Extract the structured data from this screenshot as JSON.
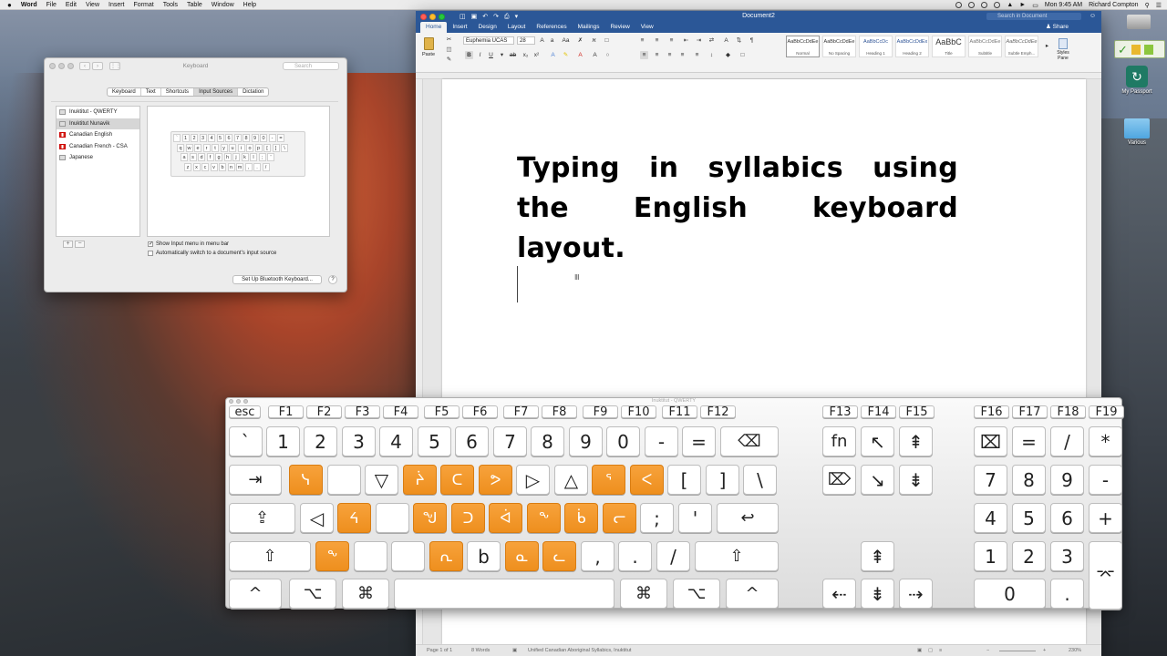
{
  "menubar": {
    "apple": "",
    "app": "Word",
    "items": [
      "File",
      "Edit",
      "View",
      "Insert",
      "Format",
      "Tools",
      "Table",
      "Window",
      "Help"
    ],
    "time": "Mon 9:45 AM",
    "user": "Richard Compton"
  },
  "desktop": {
    "icons": [
      {
        "label": "",
        "icon": "hard-drive-icon"
      },
      {
        "label": "My Passport",
        "icon": "time-machine-drive-icon"
      },
      {
        "label": "Various",
        "icon": "folder-icon"
      }
    ]
  },
  "prefs": {
    "title": "Keyboard",
    "search_placeholder": "Search",
    "tabs": [
      "Keyboard",
      "Text",
      "Shortcuts",
      "Input Sources",
      "Dictation"
    ],
    "selected_tab": "Input Sources",
    "sources": [
      {
        "label": "Inuktitut - QWERTY",
        "flag": "generic",
        "selected": false
      },
      {
        "label": "Inuktitut Nunavik",
        "flag": "generic",
        "selected": true
      },
      {
        "label": "Canadian English",
        "flag": "canada",
        "selected": false
      },
      {
        "label": "Canadian French - CSA",
        "flag": "canada",
        "selected": false
      },
      {
        "label": "Japanese",
        "flag": "generic",
        "selected": false
      }
    ],
    "preview_rows": [
      [
        "`",
        "1",
        "2",
        "3",
        "4",
        "5",
        "6",
        "7",
        "8",
        "9",
        "0",
        "-",
        "="
      ],
      [
        "q",
        "w",
        "e",
        "r",
        "t",
        "y",
        "u",
        "i",
        "o",
        "p",
        "[",
        "]",
        "\\"
      ],
      [
        "a",
        "s",
        "d",
        "f",
        "g",
        "h",
        "j",
        "k",
        "l",
        ";",
        "'"
      ],
      [
        "z",
        "x",
        "c",
        "v",
        "b",
        "n",
        "m",
        ",",
        ".",
        "/"
      ]
    ],
    "add_label": "+",
    "remove_label": "−",
    "checkbox1": "Show Input menu in menu bar",
    "checkbox1_checked": true,
    "checkbox2": "Automatically switch to a document’s input source",
    "checkbox2_checked": false,
    "bluetooth_button": "Set Up Bluetooth Keyboard...",
    "help": "?"
  },
  "word": {
    "doc_title": "Document2",
    "search_placeholder": "Search in Document",
    "tabs": [
      "Home",
      "Insert",
      "Design",
      "Layout",
      "References",
      "Mailings",
      "Review",
      "View"
    ],
    "selected_tab": "Home",
    "share": "Share",
    "paste_label": "Paste",
    "font_name": "Euphemia UCAS",
    "font_size": "28",
    "styles": [
      {
        "preview": "AaBbCcDdEe",
        "name": "Normal"
      },
      {
        "preview": "AaBbCcDdEe",
        "name": "No Spacing"
      },
      {
        "preview": "AaBbCcDc",
        "name": "Heading 1"
      },
      {
        "preview": "AaBbCcDdEx",
        "name": "Heading 2"
      },
      {
        "preview": "AaBbC",
        "name": "Title"
      },
      {
        "preview": "AaBbCcDdEe",
        "name": "Subtitle"
      },
      {
        "preview": "AaBbCcDdEe",
        "name": "Subtle Emph..."
      }
    ],
    "styles_pane": "Styles Pane",
    "document_text": "Typing in syllabics using the English keyboard layout.",
    "status": {
      "page": "Page 1 of 1",
      "words": "8 Words",
      "language": "Unified Canadian Aboriginal Syllabics, Inuktitut",
      "zoom": "230%"
    }
  },
  "keyboard_viewer": {
    "title": "Inuktitut - QWERTY",
    "accent_color": "#f0941f"
  }
}
